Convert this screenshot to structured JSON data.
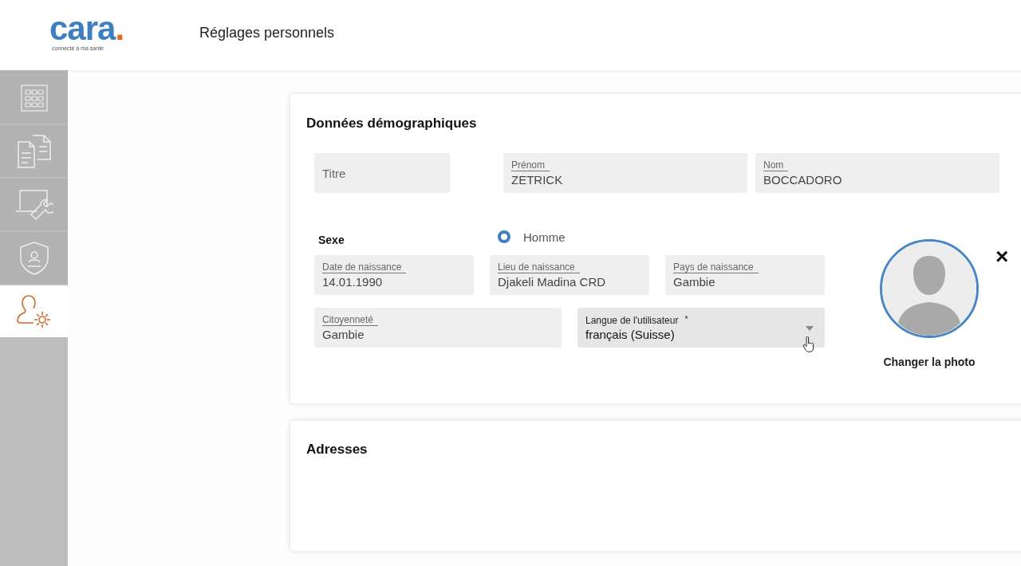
{
  "header": {
    "logo": "cara",
    "logo_dot": ".",
    "tagline": "connecté à ma santé",
    "title": "Réglages personnels"
  },
  "sidebar": {
    "items": [
      {
        "kind": "grid",
        "selected": false
      },
      {
        "kind": "documents",
        "selected": false
      },
      {
        "kind": "laptop-wrench",
        "selected": false
      },
      {
        "kind": "shield-user",
        "selected": false
      },
      {
        "kind": "user-gear",
        "selected": true
      }
    ]
  },
  "demographics": {
    "title": "Données démographiques",
    "titre": {
      "placeholder": "Titre"
    },
    "prenom": {
      "label": "Prénom",
      "value": "ZETRICK"
    },
    "nom": {
      "label": "Nom",
      "value": "BOCCADORO"
    },
    "sexe": {
      "label": "Sexe",
      "options": [
        {
          "label": "Homme",
          "selected": true
        }
      ]
    },
    "row_birth": [
      {
        "label": "Date de naissance",
        "value": "14.01.1990"
      },
      {
        "label": "Lieu de naissance",
        "value": "Djakeli Madina CRD"
      },
      {
        "label": "Pays de naissance",
        "value": "Gambie"
      }
    ],
    "citoyennete": {
      "label": "Citoyenneté",
      "value": "Gambie"
    },
    "langue": {
      "label": "Langue de l'utilisateur",
      "required_mark": "*",
      "value": "français (Suisse)"
    },
    "photo": {
      "button": "Changer la photo",
      "remove": "×"
    }
  },
  "addresses": {
    "title": "Adresses"
  }
}
